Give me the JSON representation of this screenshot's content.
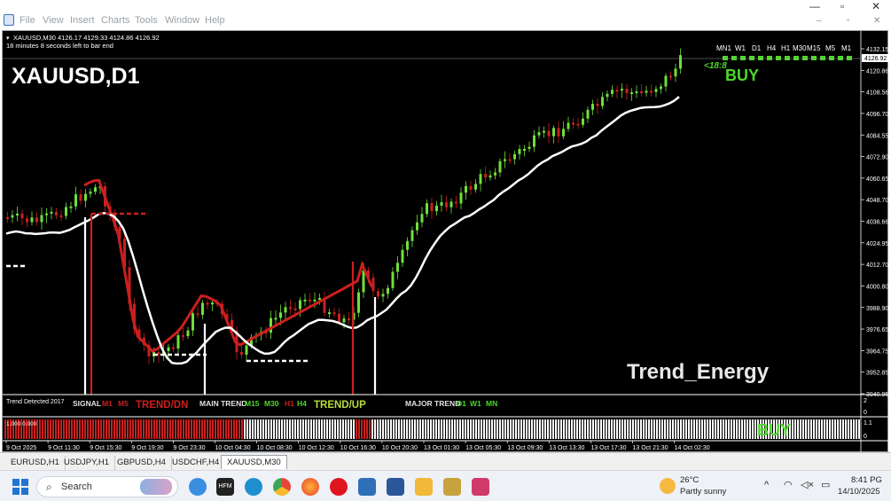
{
  "menu": {
    "items": [
      "File",
      "View",
      "Insert",
      "Charts",
      "Tools",
      "Window",
      "Help"
    ]
  },
  "window_controls": {
    "minimize": "—",
    "restore": "▫",
    "close": "✕"
  },
  "chart": {
    "header_line": "XAUUSD,M30  4126.17 4129.33 4124.86 4126.92",
    "bar_timer": "18 minutes 8 seconds left to bar end",
    "big_symbol": "XAUUSD,D1",
    "timeframe_labels": [
      "MN1",
      "W1",
      "D1",
      "H4",
      "H1",
      "M30",
      "M15",
      "M5",
      "M1"
    ],
    "countdown": "<18:8",
    "signal_buy": "BUY",
    "brand": "Trend_Energy",
    "current_price": "4126.92",
    "price_ticks": [
      "4132.15",
      "4120.86",
      "4108.56",
      "4096.70",
      "4084.55",
      "4072.90",
      "4060.65",
      "4048.70",
      "4036.66",
      "4024.95",
      "4012.70",
      "4000.80",
      "3988.90",
      "3976.65",
      "3964.75",
      "3952.85",
      "3940.95"
    ],
    "time_ticks": [
      "9 Oct 2025",
      "9 Oct 11:30",
      "9 Oct 15:30",
      "9 Oct 19:30",
      "9 Oct 23:30",
      "10 Oct 04:30",
      "10 Oct 08:30",
      "10 Oct 12:30",
      "10 Oct 16:30",
      "10 Oct 20:30",
      "13 Oct 01:30",
      "13 Oct 05:30",
      "13 Oct 09:30",
      "13 Oct 13:30",
      "13 Oct 17:30",
      "13 Oct 21:30",
      "14 Oct 02:30"
    ],
    "dash_panel": {
      "trend_detected": "Trend Detected 2017",
      "signal_label": "SIGNAL",
      "signal_m1": "M1",
      "signal_m5": "M5",
      "signal_state": "TREND/DN",
      "main_label": "MAIN TREND",
      "main_m15": "M15",
      "main_m30": "M30",
      "main_h1": "H1",
      "main_h4": "H4",
      "main_state": "TREND/UP",
      "major_label": "MAJOR TREND",
      "major_d1": "D1",
      "major_w1": "W1",
      "major_mn": "MN",
      "axis_top": "2",
      "axis_bottom": "0"
    },
    "hist_panel": {
      "label": "1.000 0.000",
      "buy": "BUY",
      "axis_top": "1.1",
      "axis_bottom": "0"
    },
    "colors": {
      "bull": "#6fe03a",
      "bear": "#cc1f1f",
      "line": "#ffffff",
      "signal": "#4dd82a",
      "grid": "#ffffff"
    }
  },
  "tabs": [
    "EURUSD,H1",
    "USDJPY,H1",
    "GBPUSD,H4",
    "USDCHF,H4",
    "XAUUSD,M30"
  ],
  "active_tab": "XAUUSD,M30",
  "taskbar": {
    "search_placeholder": "Search",
    "weather_temp": "26°C",
    "weather_desc": "Partly sunny",
    "time": "8:41 PG",
    "date": "14/10/2025"
  }
}
